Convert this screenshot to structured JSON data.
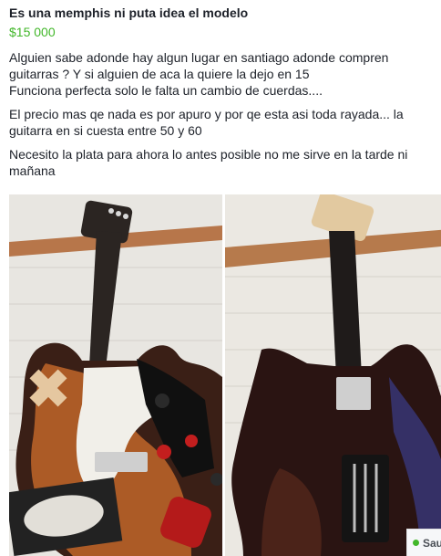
{
  "post": {
    "title": "Es una memphis ni puta idea el modelo",
    "price": "$15 000",
    "description": [
      [
        "Alguien sabe adonde hay algun lugar en santiago adonde compren",
        "guitarras ? Y si alguien de aca la quiere la dejo en 15",
        "Funciona perfecta solo le falta un cambio de cuerdas...."
      ],
      [
        "El precio mas qe nada es por apuro y por qe esta asi toda rayada... la",
        "guitarra en si cuesta entre 50 y 60"
      ],
      [
        "Necesito la plata para ahora lo antes posible no me sirve en la tarde ni",
        "mañana"
      ]
    ]
  },
  "photos": [
    {
      "name": "guitar-front-photo",
      "colors": {
        "wall": "#e8e6e1",
        "rack": "#b7764a",
        "body": "#3a1f16",
        "sunburst": "#c96a2a",
        "pickguard": "#f1efe9",
        "neck": "#2b2522"
      }
    },
    {
      "name": "guitar-back-photo",
      "colors": {
        "wall": "#ebe8e2",
        "rack": "#b67a4c",
        "body": "#2a1412",
        "neck": "#1f1b1a"
      }
    }
  ],
  "chat": {
    "status_color": "#42b72a",
    "contact_name": "Saul C"
  }
}
